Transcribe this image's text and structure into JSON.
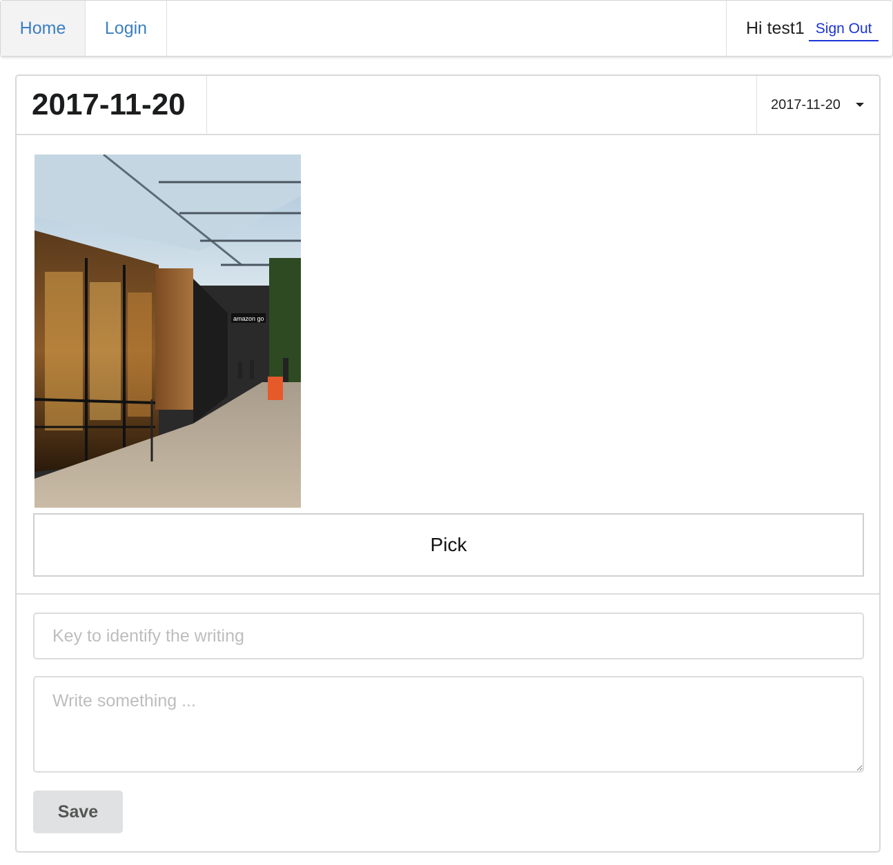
{
  "nav": {
    "home_label": "Home",
    "login_label": "Login",
    "greeting": "Hi test1",
    "signout_label": "Sign Out"
  },
  "entry": {
    "date_title": "2017-11-20",
    "date_selected": "2017-11-20",
    "photo_subject": "storefront-photo",
    "photo_sign_text": "amazon go",
    "pick_label": "Pick",
    "key_placeholder": "Key to identify the writing",
    "key_value": "",
    "write_placeholder": "Write something ...",
    "write_value": "",
    "save_label": "Save"
  },
  "colors": {
    "link": "#3b7ec2",
    "signout": "#1a33d6",
    "save_bg": "#e0e1e2"
  }
}
